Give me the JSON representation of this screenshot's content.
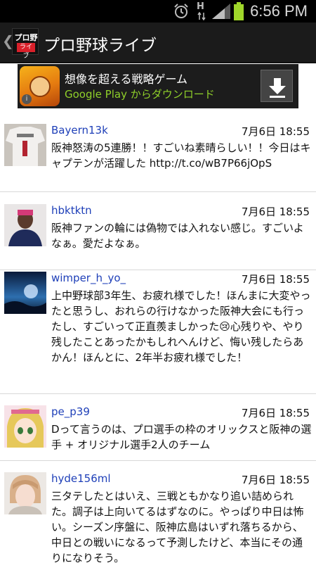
{
  "status_bar": {
    "time": "6:56 PM",
    "network": "H"
  },
  "app": {
    "title": "プロ野球ライブ",
    "logo_line1": "プロ野球",
    "logo_line2": "ライブ",
    "back_glyph": "❮"
  },
  "ad": {
    "title": "想像を超える戦略ゲーム",
    "subtitle": "Google Play からダウンロード",
    "info_glyph": "i",
    "accent_color": "#8fd02a"
  },
  "tweets": [
    {
      "user": "Bayern13k",
      "date": "7月6日 18:55",
      "text": "阪神怒涛の5連勝！！すごいね素晴らしい！！今日はキャプテンが活躍した http://t.co/wB7P66jOpS",
      "avatar": "jersey"
    },
    {
      "user": "hbktktn",
      "date": "7月6日 18:55",
      "text": "阪神ファンの輪には偽物では入れない感じ。すごいよなぁ。愛だよなぁ。",
      "avatar": "person"
    },
    {
      "user": "wimper_h_yo_",
      "date": "7月6日 18:55",
      "text": "上中野球部3年生、お疲れ様でした！ほんまに大変やったと思うし、おれらの行けなかった阪神大会にも行ったし、すごいって正直羨ましかった😢心残りや、やり残したことあったかもしれへんけど、悔い残したらあかん！ほんとに、2年半お疲れ様でした！",
      "avatar": "landscape"
    },
    {
      "user": "pe_p39",
      "date": "7月6日 18:55",
      "text": "Dって言うのは、プロ選手の枠のオリックスと阪神の選手 + オリジナル選手2人のチーム",
      "avatar": "anime"
    },
    {
      "user": "hyde156ml",
      "date": "7月6日 18:55",
      "text": "三タテしたとはいえ、三戦ともかなり追い詰められた。調子は上向いてるはずなのに。やっぱり中日は怖い。シーズン序盤に、阪神広島はいずれ落ちるから、中日との戦いになるって予測したけど、本当にその通りになりそう。",
      "avatar": "portrait"
    }
  ]
}
